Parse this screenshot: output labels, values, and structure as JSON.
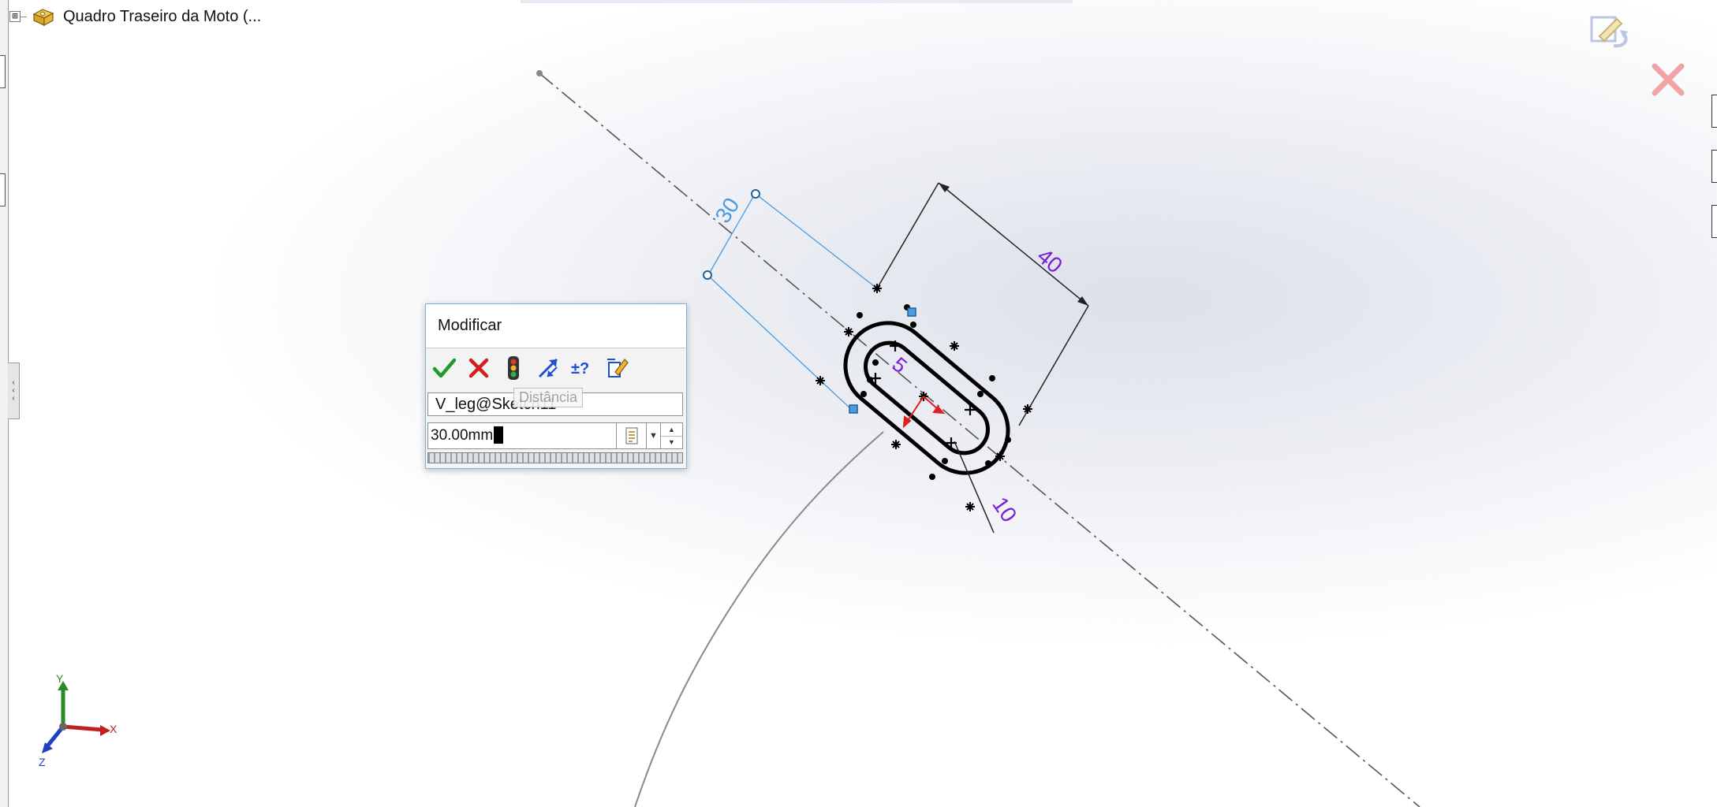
{
  "feature_tree": {
    "expand_symbol": "⊞",
    "part_name": "Quadro Traseiro da Moto  (..."
  },
  "sketch": {
    "dimensions": {
      "dim_30": "30",
      "dim_40": "40",
      "dim_5": "5",
      "dim_10": "10"
    },
    "colors": {
      "driven_dimension": "#4a9be0",
      "driving_dimension": "#7a1fd8",
      "sketch_geometry": "#000000",
      "centerline": "#555555"
    }
  },
  "modify_dialog": {
    "title": "Modificar",
    "toolbar": {
      "ok_icon": "check-icon",
      "cancel_icon": "x-icon",
      "rebuild_icon": "traffic-light-icon",
      "reverse_icon": "reverse-direction-icon",
      "mark_icon": "plus-minus-question-icon",
      "tolerance_icon": "dimension-pencil-icon"
    },
    "dimension_name": "V_leg@Sketch11",
    "tooltip": "Distância",
    "value": "30.00mm",
    "units_icon": "equation-list-icon"
  },
  "triad": {
    "x_label": "X",
    "y_label": "Y",
    "z_label": "Z"
  }
}
